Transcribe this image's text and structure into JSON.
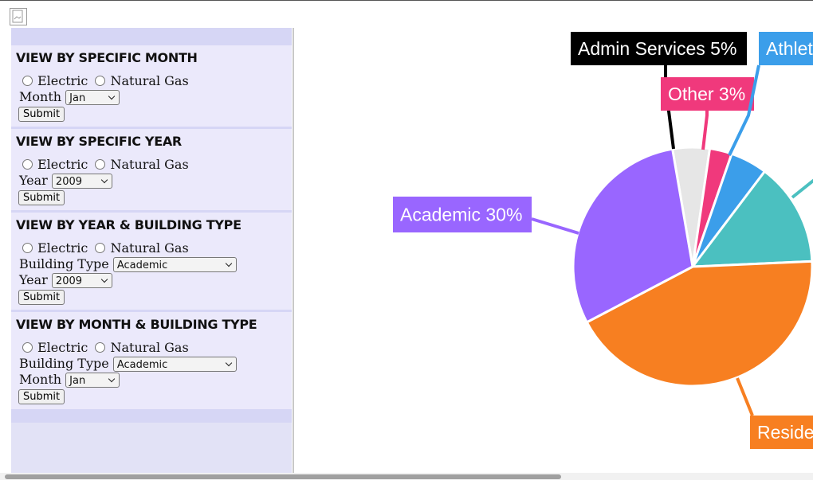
{
  "forms": {
    "month": {
      "title": "VIEW BY SPECIFIC MONTH",
      "electric": "Electric",
      "gas": "Natural Gas",
      "month_label": "Month",
      "month_value": "Jan",
      "submit": "Submit"
    },
    "year": {
      "title": "VIEW BY SPECIFIC YEAR",
      "electric": "Electric",
      "gas": "Natural Gas",
      "year_label": "Year",
      "year_value": "2009",
      "submit": "Submit"
    },
    "year_building": {
      "title": "VIEW BY YEAR & BUILDING TYPE",
      "electric": "Electric",
      "gas": "Natural Gas",
      "building_label": "Building Type",
      "building_value": "Academic",
      "year_label": "Year",
      "year_value": "2009",
      "submit": "Submit"
    },
    "month_building": {
      "title": "VIEW BY MONTH & BUILDING TYPE",
      "electric": "Electric",
      "gas": "Natural Gas",
      "building_label": "Building Type",
      "building_value": "Academic",
      "month_label": "Month",
      "month_value": "Jan",
      "submit": "Submit"
    }
  },
  "chart_data": {
    "type": "pie",
    "slices": [
      {
        "label": "Admin Services 5%",
        "value": 5,
        "color": "#e6e6e6",
        "label_color": "#000000"
      },
      {
        "label": "Other 3%",
        "value": 3,
        "color": "#f0397c",
        "label_color": "#f0397c"
      },
      {
        "label": "Athlet",
        "value": 5,
        "color": "#3b9eea",
        "label_color": "#3b9eea"
      },
      {
        "label": "",
        "value": 14,
        "color": "#4bc0c0",
        "label_color": "#4bc0c0"
      },
      {
        "label": "Reside",
        "value": 43,
        "color": "#f77f21",
        "label_color": "#f77f21"
      },
      {
        "label": "Academic 30%",
        "value": 30,
        "color": "#9966ff",
        "label_color": "#9966ff"
      }
    ]
  }
}
